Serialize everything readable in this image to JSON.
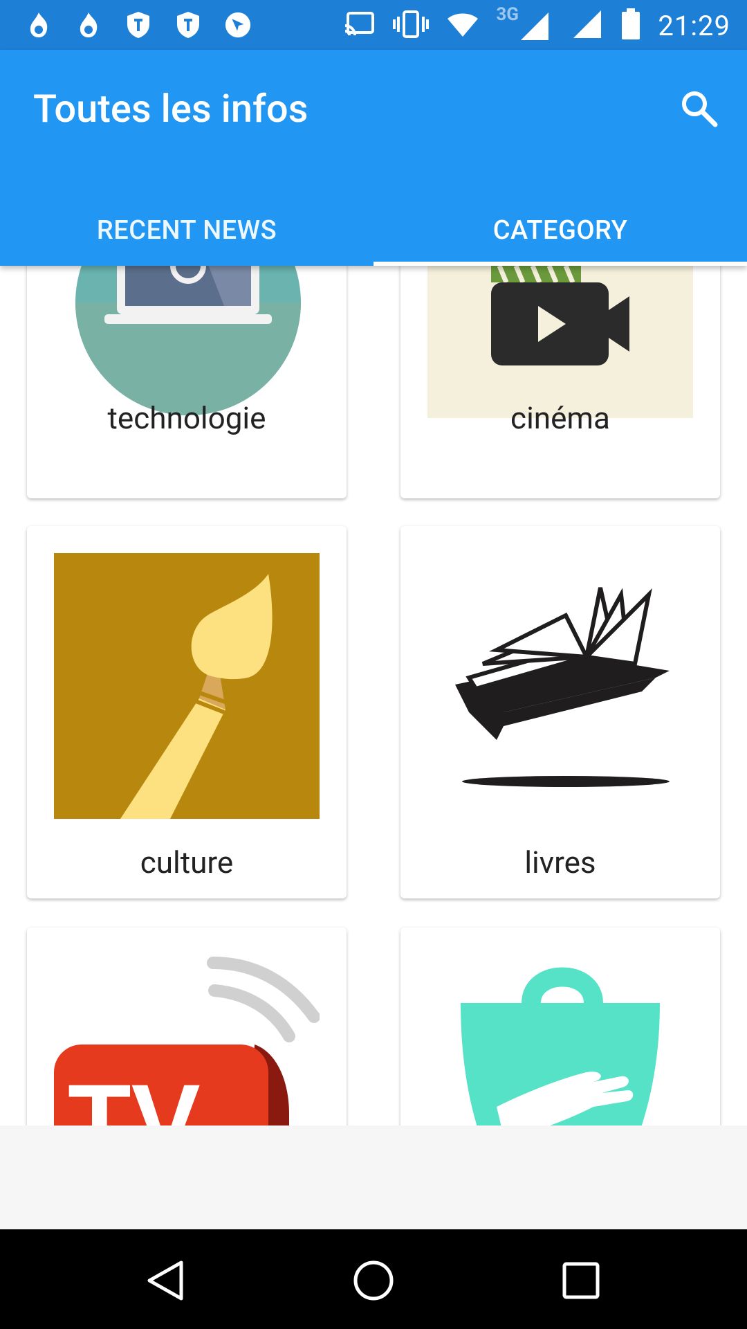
{
  "status_bar": {
    "time": "21:29",
    "network": "3G",
    "left_icons": [
      "flame-icon",
      "flame-icon",
      "shield-icon",
      "shield-icon",
      "location-arrow-icon"
    ],
    "right_icons": [
      "cast-icon",
      "vibrate-icon",
      "wifi-icon",
      "signal-icon",
      "signal-icon",
      "battery-icon"
    ]
  },
  "app_bar": {
    "title": "Toutes les infos",
    "search_icon": "search-icon",
    "color": "#2196f3"
  },
  "tabs": [
    {
      "label": "RECENT NEWS",
      "selected": false
    },
    {
      "label": "CATEGORY",
      "selected": true
    }
  ],
  "categories": [
    {
      "label": "technologie",
      "icon": "laptop-icon"
    },
    {
      "label": "cinéma",
      "icon": "film-camera-icon"
    },
    {
      "label": "culture",
      "icon": "paintbrush-icon"
    },
    {
      "label": "livres",
      "icon": "book-icon"
    },
    {
      "label": "",
      "icon": "tv-broadcast-icon"
    },
    {
      "label": "",
      "icon": "shopping-bag-icon"
    }
  ],
  "nav_bar": {
    "back": "back-icon",
    "home": "home-icon",
    "recents": "recents-icon"
  }
}
